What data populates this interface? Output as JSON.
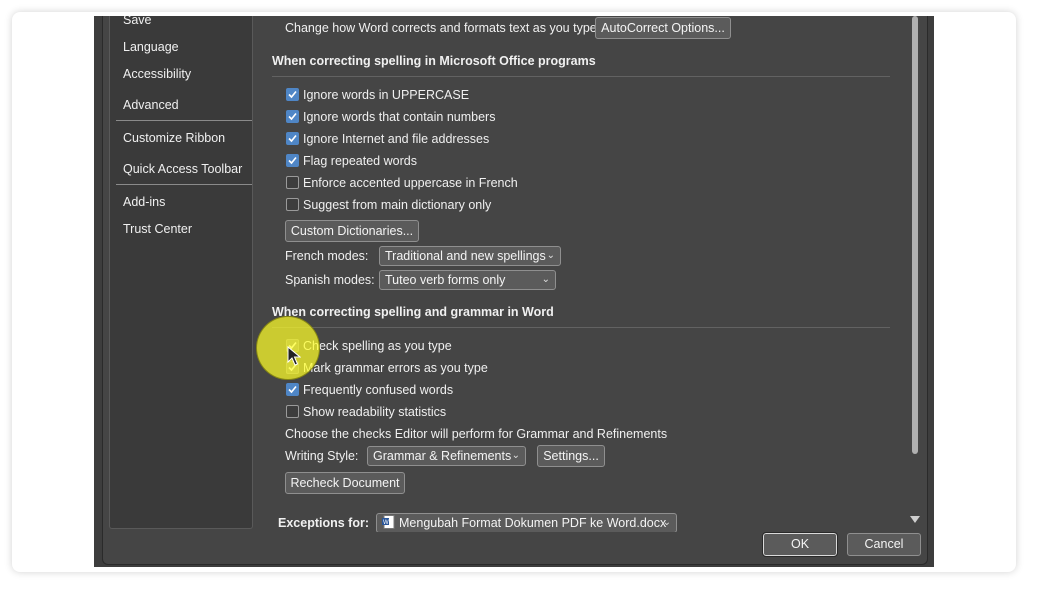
{
  "sidebar": {
    "items": [
      "Save",
      "Language",
      "Accessibility",
      "Advanced",
      "Customize Ribbon",
      "Quick Access Toolbar",
      "Add-ins",
      "Trust Center"
    ]
  },
  "autocorrect": {
    "label": "Change how Word corrects and formats text as you type:",
    "button": "AutoCorrect Options..."
  },
  "office_section": {
    "title": "When correcting spelling in Microsoft Office programs",
    "options": [
      {
        "label": "Ignore words in UPPERCASE",
        "checked": true
      },
      {
        "label": "Ignore words that contain numbers",
        "checked": true
      },
      {
        "label": "Ignore Internet and file addresses",
        "checked": true
      },
      {
        "label": "Flag repeated words",
        "checked": true
      },
      {
        "label": "Enforce accented uppercase in French",
        "checked": false
      },
      {
        "label": "Suggest from main dictionary only",
        "checked": false
      }
    ],
    "custom_dictionaries_button": "Custom Dictionaries...",
    "french_modes_label": "French modes:",
    "french_modes_value": "Traditional and new spellings",
    "spanish_modes_label": "Spanish modes:",
    "spanish_modes_value": "Tuteo verb forms only"
  },
  "word_section": {
    "title": "When correcting spelling and grammar in Word",
    "options": [
      {
        "label": "Check spelling as you type",
        "checked": true
      },
      {
        "label": "Mark grammar errors as you type",
        "checked": true
      },
      {
        "label": "Frequently confused words",
        "checked": true
      },
      {
        "label": "Show readability statistics",
        "checked": false
      }
    ],
    "checks_text": "Choose the checks Editor will perform for Grammar and Refinements",
    "writing_style_label": "Writing Style:",
    "writing_style_value": "Grammar & Refinements",
    "settings_button": "Settings...",
    "recheck_button": "Recheck Document"
  },
  "exceptions": {
    "label": "Exceptions for:",
    "value": "Mengubah Format Dokumen PDF ke Word.docx"
  },
  "footer": {
    "ok": "OK",
    "cancel": "Cancel"
  },
  "colors": {
    "dialog_bg": "#454545",
    "checkbox_checked": "#4f86c6",
    "cursor_highlight": "#ffff28"
  }
}
